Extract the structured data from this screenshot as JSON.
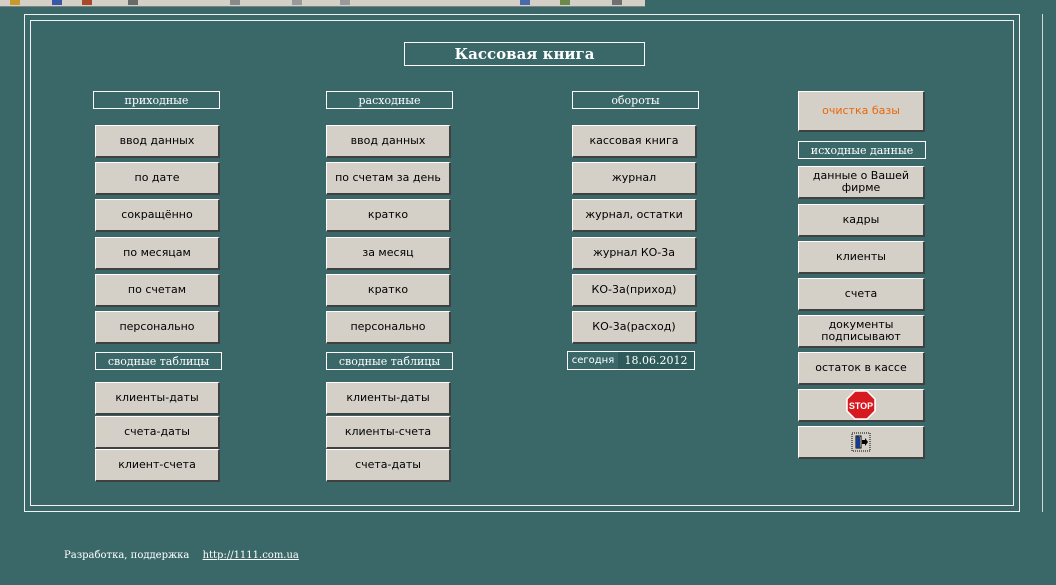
{
  "title": "Кассовая книга",
  "columns": {
    "incoming": {
      "header": "приходные",
      "buttons": [
        "ввод данных",
        "по дате",
        "сокращённо",
        "по  месяцам",
        "по счетам",
        "персонально"
      ],
      "summary_header": "сводные таблицы",
      "summary_buttons": [
        "клиенты-даты",
        "счета-даты",
        "клиент-счета"
      ]
    },
    "outgoing": {
      "header": "расходные",
      "buttons": [
        "ввод данных",
        "по счетам за день",
        "кратко",
        "за месяц",
        "кратко",
        "персонально"
      ],
      "summary_header": "сводные таблицы",
      "summary_buttons": [
        "клиенты-даты",
        "клиенты-счета",
        "счета-даты"
      ]
    },
    "turnover": {
      "header": "обороты",
      "buttons": [
        "кассовая книга",
        "журнал",
        "журнал, остатки",
        "журнал КО-3а",
        "КО-3а(приход)",
        "КО-3а(расход)"
      ],
      "today_label": "сегодня",
      "today_value": "18.06.2012"
    },
    "source": {
      "clear_db": "очистка базы",
      "header": "исходные данные",
      "buttons": [
        "данные о Вашей фирме",
        "кадры",
        "клиенты",
        "счета",
        "документы подписывают",
        "остаток в кассе"
      ],
      "stop_text": "STOP",
      "stop_icon": "stop-sign-icon",
      "exit_icon": "exit-door-icon"
    }
  },
  "footer": {
    "text": "Разработка, поддержка",
    "link": "http://1111.com.ua"
  },
  "colors": {
    "background": "#3a6868",
    "button_face": "#d4d0c8",
    "accent_orange": "#e8680a",
    "stop_red": "#d71920"
  }
}
